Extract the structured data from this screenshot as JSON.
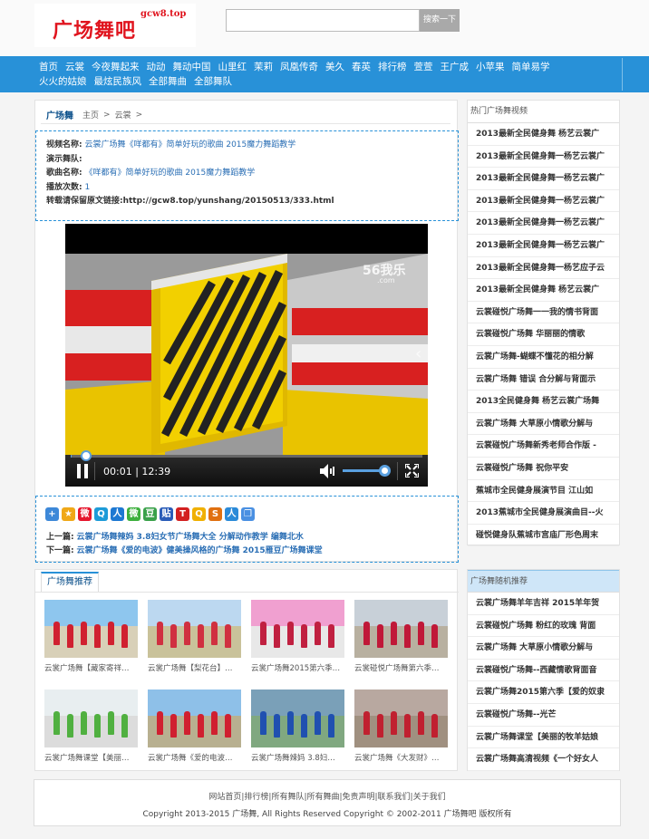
{
  "header": {
    "logo_text": "广场舞吧",
    "logo_domain": "gcw8.top",
    "search_placeholder": "",
    "search_button": "搜索一下"
  },
  "nav": {
    "row1": [
      "首页",
      "云裳",
      "今夜舞起来",
      "动动",
      "舞动中国",
      "山里红",
      "茉莉",
      "凤凰传奇",
      "美久",
      "春英",
      "排行榜",
      "萱萱",
      "王广成",
      "小苹果",
      "简单易学"
    ],
    "row2": [
      "火火的姑娘",
      "最炫民族风",
      "全部舞曲",
      "全部舞队"
    ]
  },
  "breadcrumb": {
    "home": "广场舞",
    "items": [
      "主页",
      "云裳"
    ],
    "sep": ">"
  },
  "info": {
    "video_name_k": "视频名称:",
    "video_name_v": "云裳广场舞《咩都有》简单好玩的歌曲 2015魔力舞蹈教学",
    "dancer_k": "演示舞队:",
    "dancer_v": "",
    "song_k": "歌曲名称:",
    "song_v": "《咩都有》简单好玩的歌曲 2015魔力舞蹈教学",
    "plays_k": "播放次数:",
    "plays_v": "1",
    "reprint": "转载请保留原文链接:http://gcw8.top/yunshang/20150513/333.html"
  },
  "player": {
    "time": "00:01 | 12:39",
    "watermark": "56我乐",
    "watermark_sub": ".com",
    "progress": 0.0013
  },
  "share": {
    "icons": [
      "plus-icon",
      "star-icon",
      "weibo-icon",
      "qzone-icon",
      "tencent-icon",
      "wechat-icon",
      "douban-icon",
      "tieba-icon",
      "t-icon",
      "qq-icon",
      "s-icon",
      "renren-icon",
      "copy-icon"
    ],
    "prev_k": "上一篇:",
    "prev_v": "云裳广场舞辣妈 3.8妇女节广场舞大全 分解动作教学 编舞北水",
    "next_k": "下一篇:",
    "next_v": "云裳广场舞《爱的电波》健美操风格的广场舞 2015雁豆广场舞课堂"
  },
  "recommend": {
    "title": "广场舞推荐",
    "items": [
      "云裳广场舞【藏家寄祥…",
      "云裳广场舞【梨花台】…",
      "云裳广场舞2015第六季…",
      "云裳碰悦广场舞第六季…",
      "云裳广场舞课堂【美丽…",
      "云裳广场舞《爱的电波…",
      "云裳广场舞辣妈 3.8妇…",
      "云裳广场舞《大发财》…"
    ]
  },
  "sidebar_hot": {
    "title": "热门广场舞视频",
    "items": [
      "2013最新全民健身舞 杨艺云裳广",
      "2013最新全民健身舞一杨艺云裳广",
      "2013最新全民健身舞一杨艺云裳广",
      "2013最新全民健身舞一杨艺云裳广",
      "2013最新全民健身舞一杨艺云裳广",
      "2013最新全民健身舞一杨艺云裳广",
      "2013最新全民健身舞一杨艺应子云",
      "2013最新全民健身舞 杨艺云裳广",
      "云裳碰悦广场舞一一我的情书背面",
      "云裳碰悦广场舞 华丽丽的情歌",
      "云裳广场舞-蝴蝶不懂花的相分解",
      "云裳广场舞 错误 合分解与背面示",
      "2013全民健身舞 杨艺云裳广场舞",
      "云裳广场舞 大草原小情歌分解与",
      "云裳碰悦广场舞新秀老师合作版 -",
      "云裳碰悦广场舞 祝你平安",
      "蕉城市全民健身展演节目 江山如",
      "2013蕉城市全民健身展演曲目--火",
      "碰悦健身队蕉城市宫庙厂形色周末"
    ]
  },
  "sidebar_random": {
    "title": "广场舞随机推荐",
    "items": [
      "云裳广场舞羊年吉祥 2015羊年贺",
      "云裳碰悦广场舞 粉红的玫瑰 背面",
      "云裳广场舞 大草原小情歌分解与",
      "云裳碰悦广场舞--西藏情歌背面音",
      "云裳广场舞2015第六季【爱的奴隶",
      "云裳碰悦广场舞--光芒",
      "云裳广场舞课堂【美丽的牧羊姑娘",
      "云裳广场舞高清视频《一个好女人"
    ]
  },
  "footer": {
    "links": "网站首页|排行榜|所有舞队|所有舞曲|免责声明|联系我们|关于我们",
    "copyright": "Copyright 2013-2015 广场舞, All Rights Reserved Copyright © 2002-2011 广场舞吧 版权所有"
  }
}
